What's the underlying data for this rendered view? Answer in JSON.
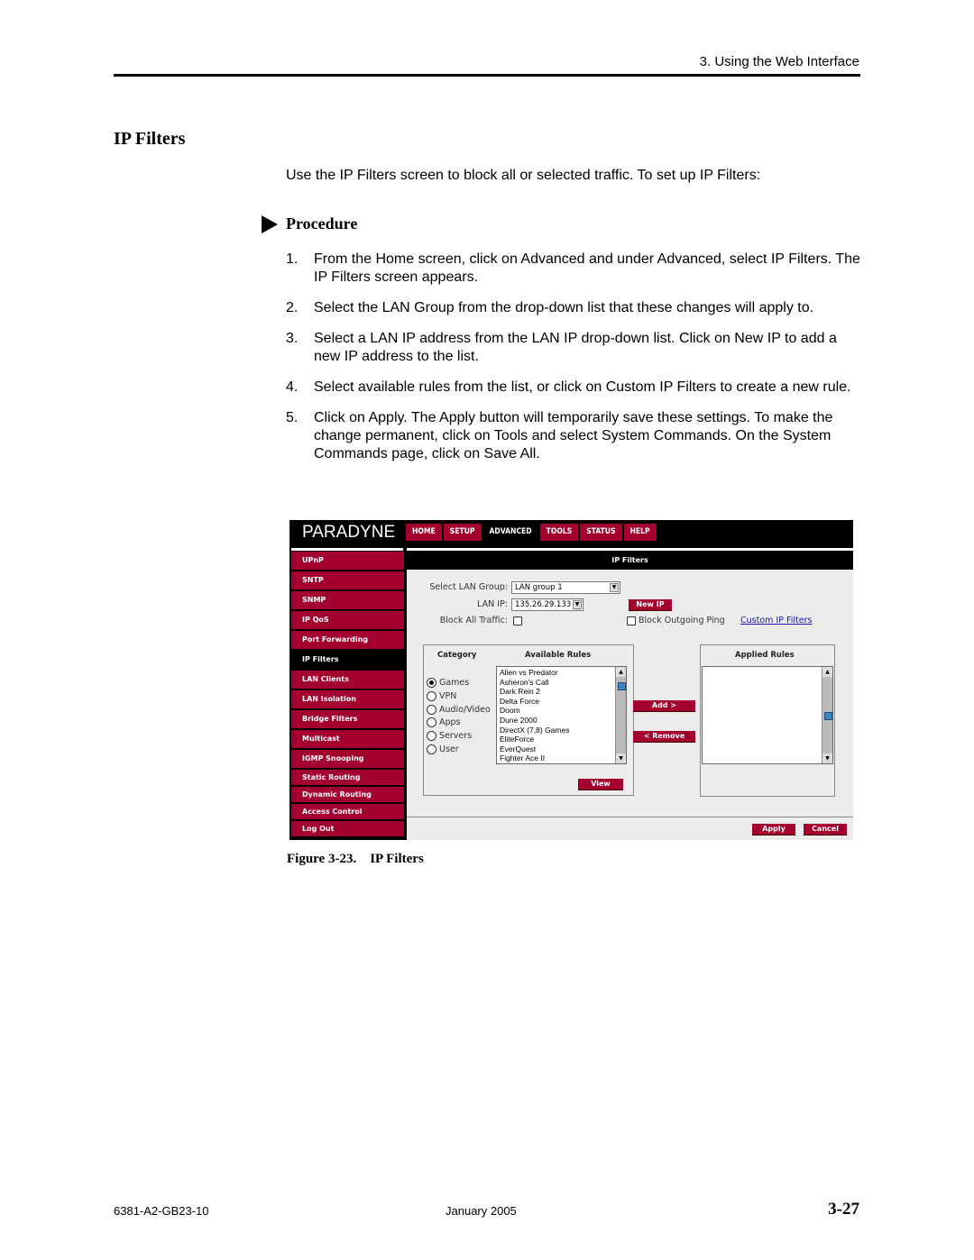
{
  "header": {
    "section": "3. Using the Web Interface"
  },
  "heading": "IP Filters",
  "intro": "Use the IP Filters screen to block all or selected traffic. To set up IP Filters:",
  "procedure_label": "Procedure",
  "steps": [
    {
      "num": "1.",
      "text": "From the Home screen, click on Advanced and under Advanced, select IP Filters. The IP Filters screen appears."
    },
    {
      "num": "2.",
      "text": "Select the LAN Group from the drop-down list that these changes will apply to."
    },
    {
      "num": "3.",
      "text": "Select a LAN IP address from the LAN IP drop-down list. Click on New IP to add a new IP address to the list."
    },
    {
      "num": "4.",
      "text": " Select available rules from the list, or click on Custom IP Filters to create a new rule."
    },
    {
      "num": "5.",
      "text": "Click on Apply. The Apply button will temporarily save these settings. To make the change permanent, click on Tools and select System Commands. On the System Commands page, click on Save All."
    }
  ],
  "screenshot": {
    "logo": "PARADYNE",
    "tabs": [
      {
        "label": "HOME",
        "active": false
      },
      {
        "label": "SETUP",
        "active": false
      },
      {
        "label": "ADVANCED",
        "active": true
      },
      {
        "label": "TOOLS",
        "active": false
      },
      {
        "label": "STATUS",
        "active": false
      },
      {
        "label": "HELP",
        "active": false
      }
    ],
    "sidebar": [
      "UPnP",
      "SNTP",
      "SNMP",
      "IP QoS",
      "Port Forwarding",
      "IP Filters",
      "LAN Clients",
      "LAN Isolation",
      "Bridge Filters",
      "Multicast",
      "IGMP Snooping",
      "Static Routing",
      "Dynamic Routing",
      "Access Control",
      "Log Out"
    ],
    "sidebar_active": "IP Filters",
    "title": "IP Filters",
    "lan_group_label": "Select LAN Group:",
    "lan_group_value": "LAN group 1",
    "lan_ip_label": "LAN IP:",
    "lan_ip_value": "135.26.29.133",
    "new_ip": "New IP",
    "block_all_label": "Block All Traffic:",
    "block_ping_label": "Block Outgoing Ping",
    "custom_link": "Custom IP Filters",
    "category_header": "Category",
    "available_header": "Available Rules",
    "applied_header": "Applied Rules",
    "categories": [
      {
        "label": "Games",
        "selected": true
      },
      {
        "label": "VPN",
        "selected": false
      },
      {
        "label": "Audio/Video",
        "selected": false
      },
      {
        "label": "Apps",
        "selected": false
      },
      {
        "label": "Servers",
        "selected": false
      },
      {
        "label": "User",
        "selected": false
      }
    ],
    "available_rules": [
      "Alien vs Predator",
      "Asheron's Call",
      "Dark Rein 2",
      "Delta Force",
      "Doom",
      "Dune 2000",
      "DirectX (7,8) Games",
      "EliteForce",
      "EverQuest",
      "Fighter Ace II"
    ],
    "applied_rules": [],
    "add_button": "Add >",
    "remove_button": "< Remove",
    "view_button": "View",
    "apply_button": "Apply",
    "cancel_button": "Cancel"
  },
  "caption": "Figure 3-23.    IP Filters",
  "footer": {
    "doc_id": "6381-A2-GB23-10",
    "date": "January 2005",
    "page": "3-27"
  }
}
